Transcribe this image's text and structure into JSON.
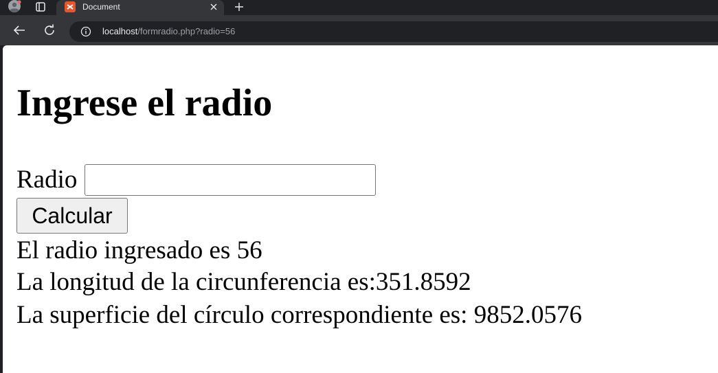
{
  "browser": {
    "tab_title": "Document",
    "url_host": "localhost",
    "url_path": "/formradio.php?radio=56"
  },
  "page": {
    "heading": "Ingrese el radio",
    "radio_label": "Radio",
    "radio_value": "",
    "button_label": "Calcular",
    "results": [
      "El radio ingresado es 56",
      "La longitud de la circunferencia es:351.8592",
      "La superficie del círculo correspondiente es: 9852.0576"
    ]
  },
  "icons": {
    "profile": "profile-avatar-icon",
    "tab_strip": "tab-strip-icon",
    "favicon": "xampp-favicon-icon",
    "close": "close-icon",
    "new_tab": "plus-icon",
    "back": "back-arrow-icon",
    "reload": "reload-icon",
    "info": "info-icon"
  },
  "colors": {
    "chrome_bg": "#202124",
    "toolbar_bg": "#35363a",
    "favicon": "#e8542c"
  }
}
